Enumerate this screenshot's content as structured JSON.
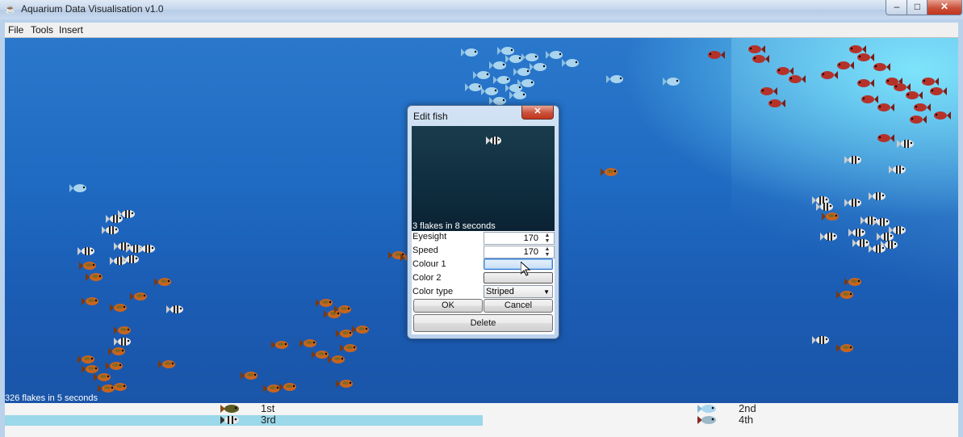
{
  "window": {
    "title": "Aquarium Data Visualisation v1.0",
    "controls": {
      "minimize": "–",
      "maximize": "□",
      "close": "✕"
    }
  },
  "menu": [
    "File",
    "Tools",
    "Insert"
  ],
  "aquarium": {
    "status": "326 flakes in 5 seconds"
  },
  "leaderboard": [
    {
      "rank": "1st"
    },
    {
      "rank": "2nd"
    },
    {
      "rank": "3rd"
    },
    {
      "rank": "4th"
    }
  ],
  "dialog": {
    "title": "Edit fish",
    "close": "✕",
    "preview_caption": "3 flakes in 8 seconds",
    "fields": {
      "eyesight": {
        "label": "Eyesight",
        "value": "170"
      },
      "speed": {
        "label": "Speed",
        "value": "170"
      },
      "colour1": {
        "label": "Colour 1"
      },
      "color2": {
        "label": "Color 2"
      },
      "color_type": {
        "label": "Color type",
        "value": "Striped"
      }
    },
    "buttons": {
      "ok": "OK",
      "cancel": "Cancel",
      "delete": "Delete"
    }
  },
  "colors": {
    "orange_fish": "#c8641e",
    "blue_fish": "#a9d4ee",
    "red_fish": "#b5322a",
    "striped_fish": "#e8e8e8",
    "water": "#1f6ac2",
    "leader_bar": "#9ad8ea"
  }
}
